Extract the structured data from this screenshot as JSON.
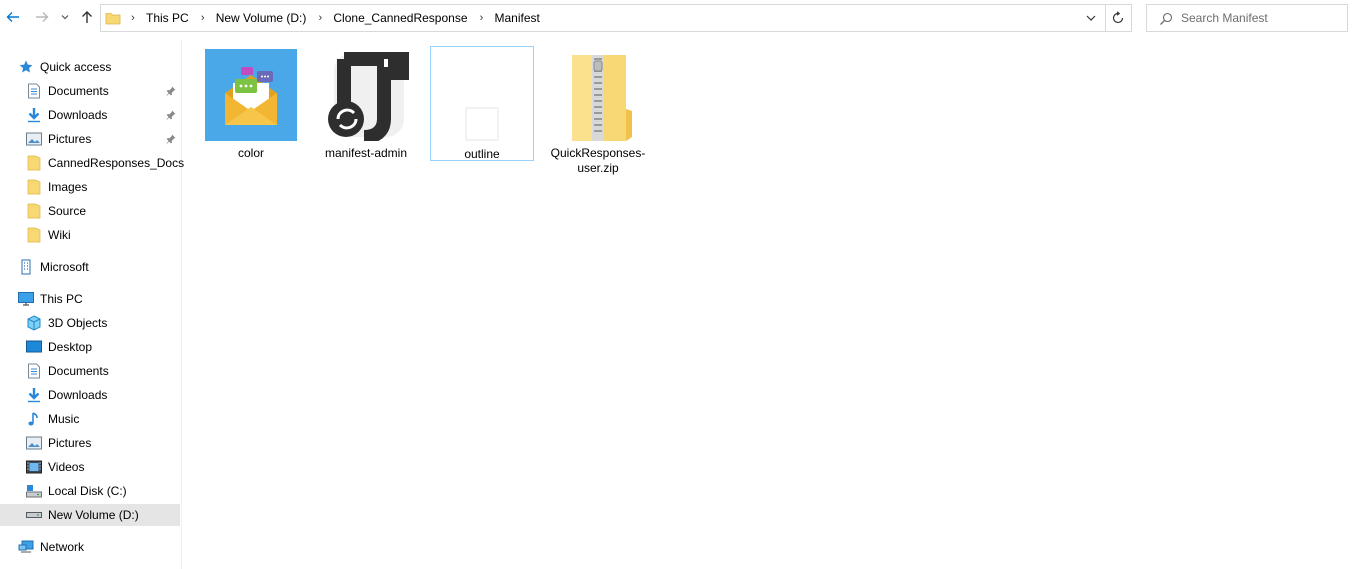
{
  "breadcrumbs": [
    "This PC",
    "New Volume (D:)",
    "Clone_CannedResponse",
    "Manifest"
  ],
  "search": {
    "placeholder": "Search Manifest"
  },
  "sidebar": {
    "quick_access": {
      "label": "Quick access",
      "items": [
        {
          "label": "Documents",
          "icon": "documents-icon",
          "pinned": true
        },
        {
          "label": "Downloads",
          "icon": "downloads-icon",
          "pinned": true
        },
        {
          "label": "Pictures",
          "icon": "pictures-icon",
          "pinned": true
        },
        {
          "label": "CannedResponses_Docs",
          "icon": "folder-icon",
          "pinned": false
        },
        {
          "label": "Images",
          "icon": "folder-icon",
          "pinned": false
        },
        {
          "label": "Source",
          "icon": "folder-icon",
          "pinned": false
        },
        {
          "label": "Wiki",
          "icon": "folder-icon",
          "pinned": false
        }
      ]
    },
    "microsoft": {
      "label": "Microsoft"
    },
    "this_pc": {
      "label": "This PC",
      "items": [
        {
          "label": "3D Objects",
          "icon": "3d-objects-icon"
        },
        {
          "label": "Desktop",
          "icon": "desktop-icon"
        },
        {
          "label": "Documents",
          "icon": "documents-icon"
        },
        {
          "label": "Downloads",
          "icon": "downloads-icon"
        },
        {
          "label": "Music",
          "icon": "music-icon"
        },
        {
          "label": "Pictures",
          "icon": "pictures-icon"
        },
        {
          "label": "Videos",
          "icon": "videos-icon"
        },
        {
          "label": "Local Disk (C:)",
          "icon": "local-disk-icon"
        },
        {
          "label": "New Volume (D:)",
          "icon": "drive-icon",
          "selected": true
        }
      ]
    },
    "network": {
      "label": "Network"
    }
  },
  "files": [
    {
      "name": "color",
      "icon": "envelope-chat-image-icon"
    },
    {
      "name": "manifest-admin",
      "icon": "json-file-icon"
    },
    {
      "name": "outline",
      "icon": "blank-image-icon",
      "focused": true
    },
    {
      "name": "QuickResponses-user.zip",
      "icon": "zip-folder-icon"
    }
  ],
  "colors": {
    "accent": "#0078d7",
    "selection_border": "#99d1ff",
    "sidebar_selected": "#e5e5e5",
    "folder_yellow": "#f8d775",
    "color_tile_bg": "#4aa8e8"
  }
}
